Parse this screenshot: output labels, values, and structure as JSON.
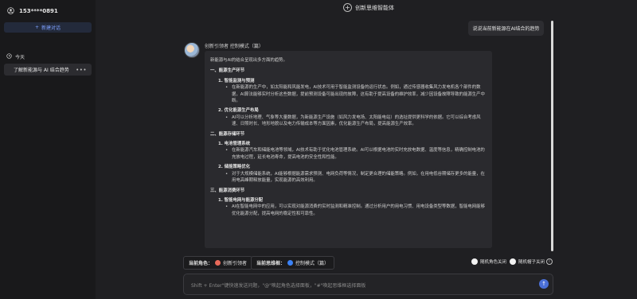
{
  "sidebar": {
    "user": "153****0891",
    "new_chat_label": "新建对话",
    "group_label": "今天",
    "conversations": [
      {
        "title": "了解新能源与 AI 结合趋势"
      }
    ]
  },
  "header": {
    "title": "创新思维智能体"
  },
  "user_message": "说说当前新能源在AI结合的趋势",
  "bot": {
    "name_line": "创新引领者  控制模式（篇）",
    "intro": "新能源与AI的结合呈现出多方面的趋势。",
    "sections": [
      {
        "title": "一、能源生产环节",
        "items": [
          {
            "title": "1. 智能监测与预测",
            "body": "在新能源的生产中，如太阳能和风能发电，AI技术可用于智能监测设备的运行状态。例如，通过传感器收集风力发电机各个部件的数据，AI算法能够实时分析这些数据，提前预测设备可能出现的故障，这有助于提高设备的维护效率，减少因设备故障导致的能源生产中断。"
          },
          {
            "title": "2. 优化能源生产布局",
            "body": "AI可以分析地理、气象等大量数据，为新能源生产设施（如风力发电场、太阳能电站）的选址提供更科学的依据。它可以综合考虑风速、日照时长、地形地貌以及电力传输成本等方面因素，优化能源生产布局，提高能源生产效率。"
          }
        ]
      },
      {
        "title": "二、能源存储环节",
        "items": [
          {
            "title": "1. 电池管理系统",
            "body": "在新能源汽车和储能电池等领域，AI技术有助于优化电池管理系统。AI可以根据电池的实时充放电数据、温度等信息，精确控制电池的充放电过程，延长电池寿命，提高电池的安全性和性能。"
          },
          {
            "title": "2. 储能策略优化",
            "body": "对于大规模储能系统，AI能够根据能源需求预测、电网负荷等情况，制定更合理的储能策略。例如，在用电低谷期储存更多的能量，在用电高峰期释放能量，实现能源的高效利用。"
          }
        ]
      },
      {
        "title": "三、能源消费环节",
        "items": [
          {
            "title": "1. 智能电网与能源分配",
            "body": "AI在智能电网中的应用，可以实现对能源消费的实时监测和精准控制。通过分析用户的用电习惯、用电设备类型等数据，智能电网能够优化能源分配，提高电网的稳定性和可靠性。"
          }
        ]
      }
    ]
  },
  "controls": {
    "role_key": "当前角色：",
    "role_value": "创新引领者",
    "mode_key": "当前思维框：",
    "mode_value": "控制模式（篇）",
    "toggle_role": "随机角色关闭",
    "toggle_hat": "随机帽子关闭",
    "info_icon_text": "i"
  },
  "input": {
    "placeholder": "Shift + Enter\"键快速发送问题，\"@\"唤起角色选择面板，\"#\"唤起思维框选择面板"
  },
  "colors": {
    "accent": "#4a6fd6",
    "role_dot": "#e86a5a",
    "mode_dot": "#3b82f6"
  },
  "icons": [
    "user-circle-icon",
    "plus-icon",
    "clock-icon",
    "more-dots-icon",
    "plus-circle-icon",
    "info-icon",
    "send-arrow-icon"
  ]
}
